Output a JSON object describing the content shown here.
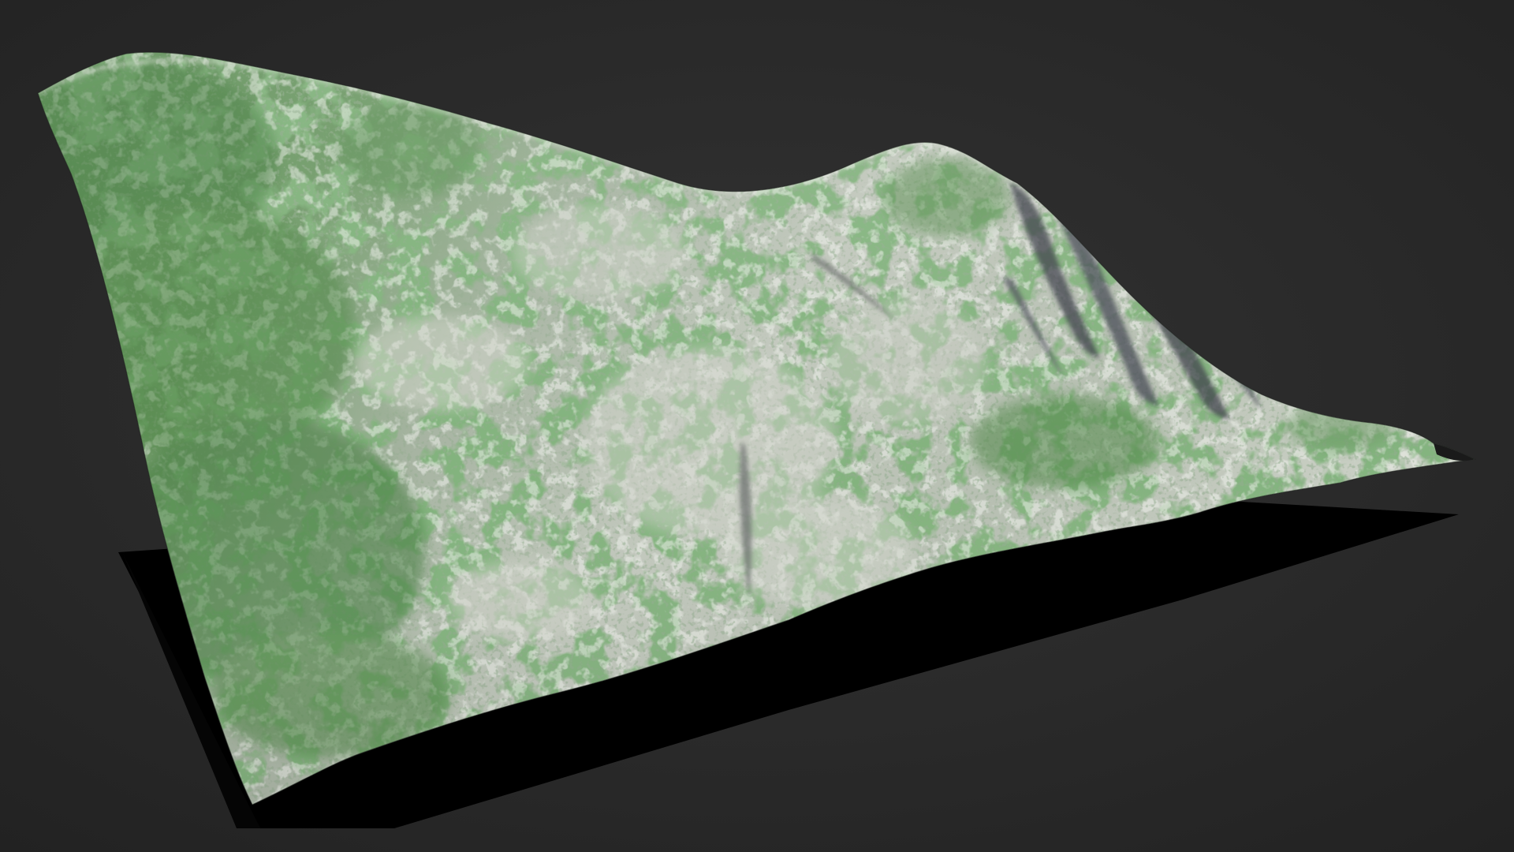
{
  "scene": {
    "background_color": "#282828",
    "background_highlight": "#333333",
    "shadow_color": "#000000",
    "terrain_colors": {
      "rock_light": "#c9cdc4",
      "rock_mid": "#a9aea4",
      "rock_shadow": "#3e4048",
      "vegetation_dark": "#34642f",
      "vegetation_mid": "#4f8a46",
      "vegetation_light": "#7fa872"
    }
  }
}
